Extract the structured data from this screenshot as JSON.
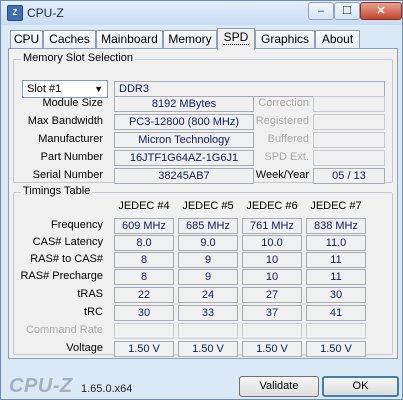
{
  "window": {
    "title": "CPU-Z",
    "icon_text": "Z",
    "controls": {
      "minimize": "–",
      "maximize": "☐",
      "close": "✕"
    }
  },
  "tabs": [
    {
      "label": "CPU",
      "active": false
    },
    {
      "label": "Caches",
      "active": false
    },
    {
      "label": "Mainboard",
      "active": false
    },
    {
      "label": "Memory",
      "active": false
    },
    {
      "label": "SPD",
      "active": true
    },
    {
      "label": "Graphics",
      "active": false
    },
    {
      "label": "About",
      "active": false
    }
  ],
  "memory_slot": {
    "group_title": "Memory Slot Selection",
    "slot_select": "Slot #1",
    "slot_arrow": "▼",
    "type": "DDR3",
    "module_size_label": "Module Size",
    "module_size": "8192 MBytes",
    "max_bandwidth_label": "Max Bandwidth",
    "max_bandwidth": "PC3-12800 (800 MHz)",
    "manufacturer_label": "Manufacturer",
    "manufacturer": "Micron Technology",
    "part_number_label": "Part Number",
    "part_number": "16JTF1G64AZ-1G6J1",
    "serial_number_label": "Serial Number",
    "serial_number": "38245AB7",
    "correction_label": "Correction",
    "correction": "",
    "registered_label": "Registered",
    "registered": "",
    "buffered_label": "Buffered",
    "buffered": "",
    "spd_ext_label": "SPD Ext.",
    "spd_ext": "",
    "week_year_label": "Week/Year",
    "week_year": "05 / 13"
  },
  "timings": {
    "group_title": "Timings Table",
    "columns": [
      "JEDEC #4",
      "JEDEC #5",
      "JEDEC #6",
      "JEDEC #7"
    ],
    "rows": [
      {
        "label": "Frequency",
        "grey": false,
        "values": [
          "609 MHz",
          "685 MHz",
          "761 MHz",
          "838 MHz"
        ]
      },
      {
        "label": "CAS# Latency",
        "grey": false,
        "values": [
          "8.0",
          "9.0",
          "10.0",
          "11.0"
        ]
      },
      {
        "label": "RAS# to CAS#",
        "grey": false,
        "values": [
          "8",
          "9",
          "10",
          "11"
        ]
      },
      {
        "label": "RAS# Precharge",
        "grey": false,
        "values": [
          "8",
          "9",
          "10",
          "11"
        ]
      },
      {
        "label": "tRAS",
        "grey": false,
        "values": [
          "22",
          "24",
          "27",
          "30"
        ]
      },
      {
        "label": "tRC",
        "grey": false,
        "values": [
          "30",
          "33",
          "37",
          "41"
        ]
      },
      {
        "label": "Command Rate",
        "grey": true,
        "values": [
          "",
          "",
          "",
          ""
        ]
      },
      {
        "label": "Voltage",
        "grey": false,
        "values": [
          "1.50 V",
          "1.50 V",
          "1.50 V",
          "1.50 V"
        ]
      }
    ]
  },
  "footer": {
    "logo": "CPU-Z",
    "version": "1.65.0.x64",
    "validate_label": "Validate",
    "ok_label": "OK"
  }
}
